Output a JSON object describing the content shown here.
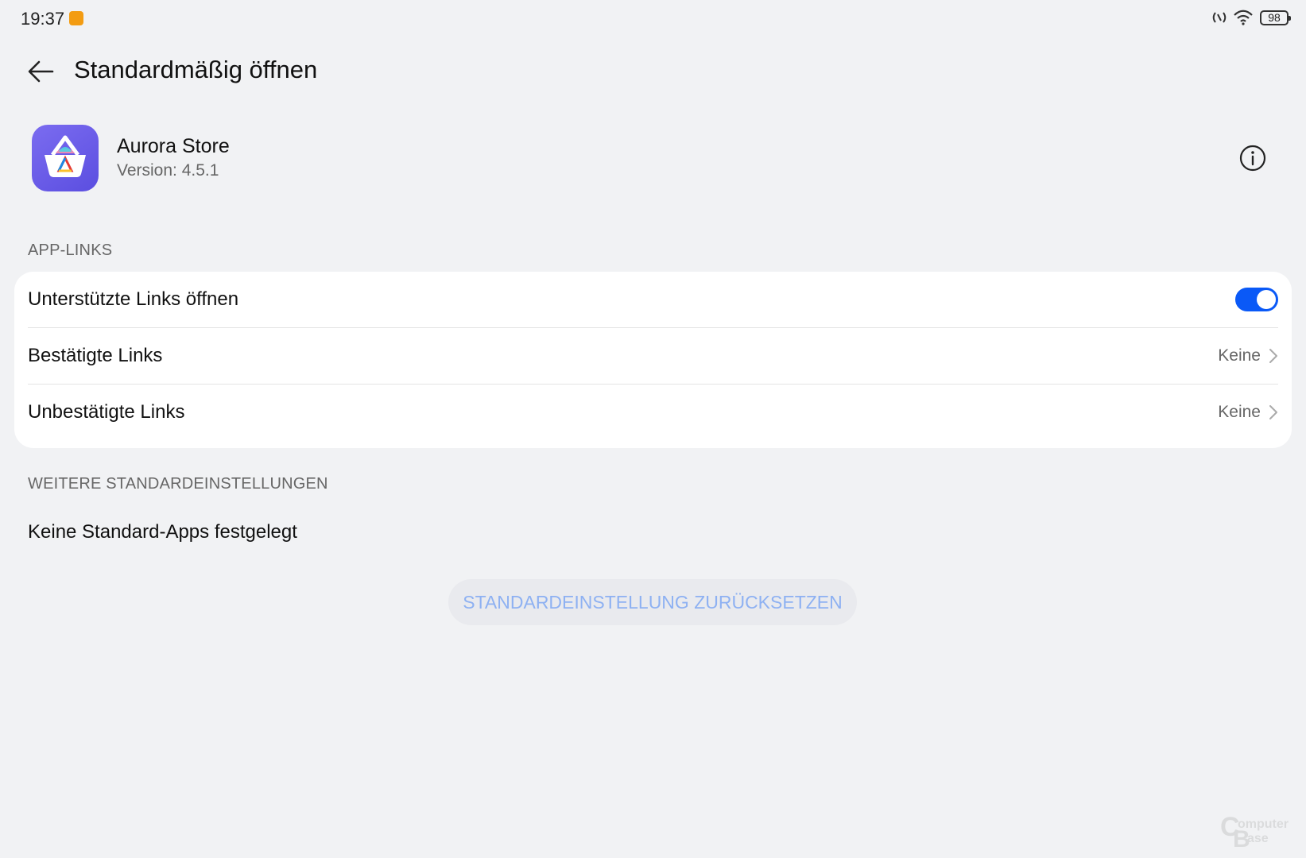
{
  "status_bar": {
    "time": "19:37",
    "battery": "98"
  },
  "header": {
    "title": "Standardmäßig öffnen"
  },
  "app": {
    "name": "Aurora Store",
    "version": "Version: 4.5.1"
  },
  "sections": {
    "app_links_label": "APP-LINKS",
    "more_defaults_label": "WEITERE STANDARDEINSTELLUNGEN"
  },
  "app_links": {
    "open_supported": {
      "label": "Unterstützte Links öffnen",
      "enabled": true
    },
    "verified": {
      "label": "Bestätigte Links",
      "value": "Keine"
    },
    "unverified": {
      "label": "Unbestätigte Links",
      "value": "Keine"
    }
  },
  "more_defaults": {
    "text": "Keine Standard-Apps festgelegt"
  },
  "reset_button": {
    "label": "STANDARDEINSTELLUNG ZURÜCKSETZEN"
  },
  "watermark": {
    "text_line1": "Computer",
    "text_line2": "Base"
  },
  "colors": {
    "accent": "#0a59f7",
    "background": "#f1f2f4",
    "app_icon": "#6c5ce7",
    "reset_text": "#8eb1f2"
  }
}
